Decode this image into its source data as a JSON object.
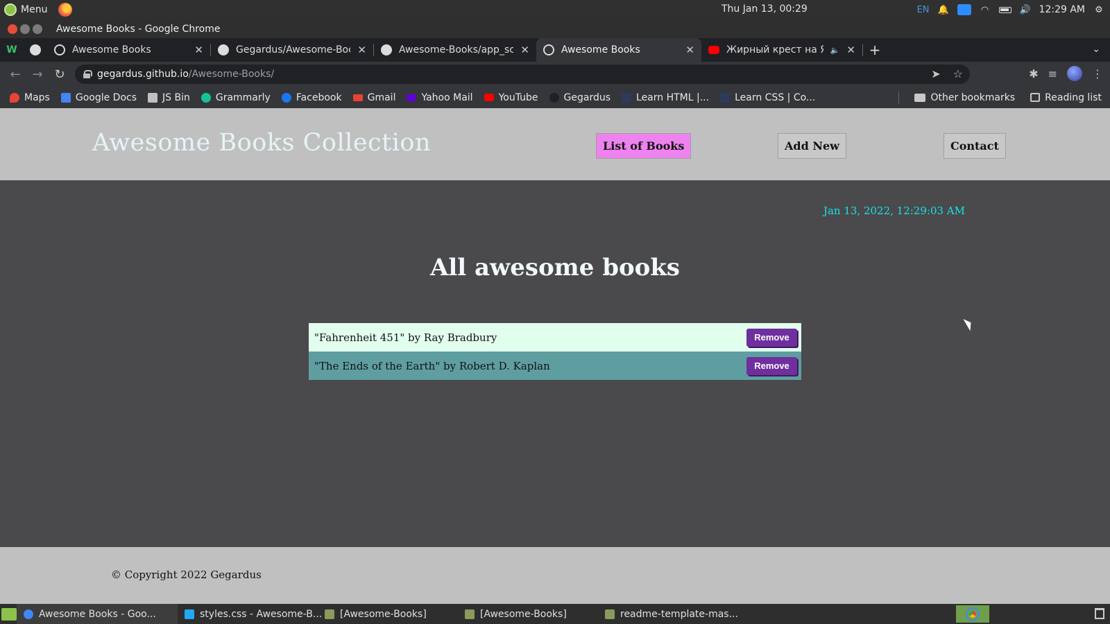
{
  "os": {
    "menu_label": "Menu",
    "clock_center": "Thu Jan 13, 00:29",
    "lang": "EN",
    "clock_right": "12:29 AM"
  },
  "window": {
    "title": "Awesome Books - Google Chrome"
  },
  "tabs": [
    {
      "label": "Awesome Books",
      "active": false
    },
    {
      "label": "Gegardus/Awesome-Boo",
      "active": false
    },
    {
      "label": "Awesome-Books/app_scr",
      "active": false
    },
    {
      "label": "Awesome Books",
      "active": true
    },
    {
      "label": "Жирный крест на Ялт",
      "active": false
    }
  ],
  "address": {
    "host": "gegardus.github.io",
    "path": "/Awesome-Books/"
  },
  "bookmarks": [
    {
      "label": "Maps",
      "color": "#ea4335"
    },
    {
      "label": "Google Docs",
      "color": "#4285f4"
    },
    {
      "label": "JS Bin",
      "color": "#c0c0c0"
    },
    {
      "label": "Grammarly",
      "color": "#15c39a"
    },
    {
      "label": "Facebook",
      "color": "#1877f2"
    },
    {
      "label": "Gmail",
      "color": "#ea4335"
    },
    {
      "label": "Yahoo Mail",
      "color": "#6001d2"
    },
    {
      "label": "YouTube",
      "color": "#ff0000"
    },
    {
      "label": "Gegardus",
      "color": "#202124"
    },
    {
      "label": "Learn HTML |...",
      "color": "#2d3a5c"
    },
    {
      "label": "Learn CSS | Co...",
      "color": "#2d3a5c"
    }
  ],
  "bookmarks_right": {
    "other": "Other bookmarks",
    "reading": "Reading list"
  },
  "site": {
    "brand": "Awesome Books Collection",
    "nav": {
      "list": "List of Books",
      "add": "Add New",
      "contact": "Contact"
    },
    "datetime": "Jan 13, 2022, 12:29:03 AM",
    "section_title": "All awesome books",
    "books": [
      {
        "text": "\"Fahrenheit 451\" by Ray Bradbury",
        "button": "Remove"
      },
      {
        "text": "\"The Ends of the Earth\" by Robert D. Kaplan",
        "button": "Remove"
      }
    ],
    "copyright": "© Copyright 2022 Gegardus"
  },
  "taskbar": [
    {
      "label": "Awesome Books - Goo...",
      "active": true,
      "color": "#4285f4"
    },
    {
      "label": "styles.css - Awesome-B...",
      "active": false,
      "color": "#23a9f2"
    },
    {
      "label": "[Awesome-Books]",
      "active": false,
      "color": "#8a9a5b"
    },
    {
      "label": "[Awesome-Books]",
      "active": false,
      "color": "#8a9a5b"
    },
    {
      "label": "readme-template-mas...",
      "active": false,
      "color": "#8a9a5b"
    }
  ],
  "colors": {
    "accent_nav_active": "#ee82ee",
    "remove_button": "#6f2f9e",
    "row_light": "#e2ffee",
    "row_dark": "#5f9ea0",
    "date_text": "#17e4e8"
  }
}
